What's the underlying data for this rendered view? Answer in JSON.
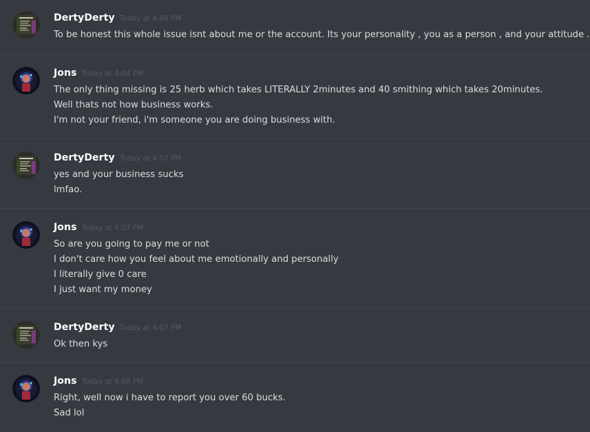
{
  "messages": [
    {
      "author": "DertyDerty",
      "avatar": "dertyderty-avatar",
      "timestamp": "Today at 4:04 PM",
      "lines": [
        "To be honest this whole issue isnt about me or the account. Its your personality , you as a person , and your attitude ."
      ]
    },
    {
      "author": "Jons",
      "avatar": "jons-avatar",
      "timestamp": "Today at 4:04 PM",
      "lines": [
        "The only thing missing is 25 herb which takes LITERALLY 2minutes and 40 smithing which takes 20minutes.",
        "Well thats not how business works.",
        "I'm not your friend, i'm someone you are doing business with."
      ]
    },
    {
      "author": "DertyDerty",
      "avatar": "dertyderty-avatar",
      "timestamp": "Today at 4:07 PM",
      "lines": [
        "yes and your business sucks",
        "lmfao."
      ]
    },
    {
      "author": "Jons",
      "avatar": "jons-avatar",
      "timestamp": "Today at 4:07 PM",
      "lines": [
        "So are you going to pay me or not",
        "I don't care how you feel about me emotionally and personally",
        "I literally give 0 care",
        "I just want my money"
      ]
    },
    {
      "author": "DertyDerty",
      "avatar": "dertyderty-avatar",
      "timestamp": "Today at 4:07 PM",
      "lines": [
        "Ok then kys"
      ]
    },
    {
      "author": "Jons",
      "avatar": "jons-avatar",
      "timestamp": "Today at 4:08 PM",
      "lines": [
        "Right, well now i have to report you over 60 bucks.",
        "Sad lol"
      ]
    }
  ],
  "colors": {
    "background": "#36393f",
    "divider": "#40434a",
    "username": "#ffffff",
    "timestamp": "#565960",
    "text": "#dcddde"
  }
}
